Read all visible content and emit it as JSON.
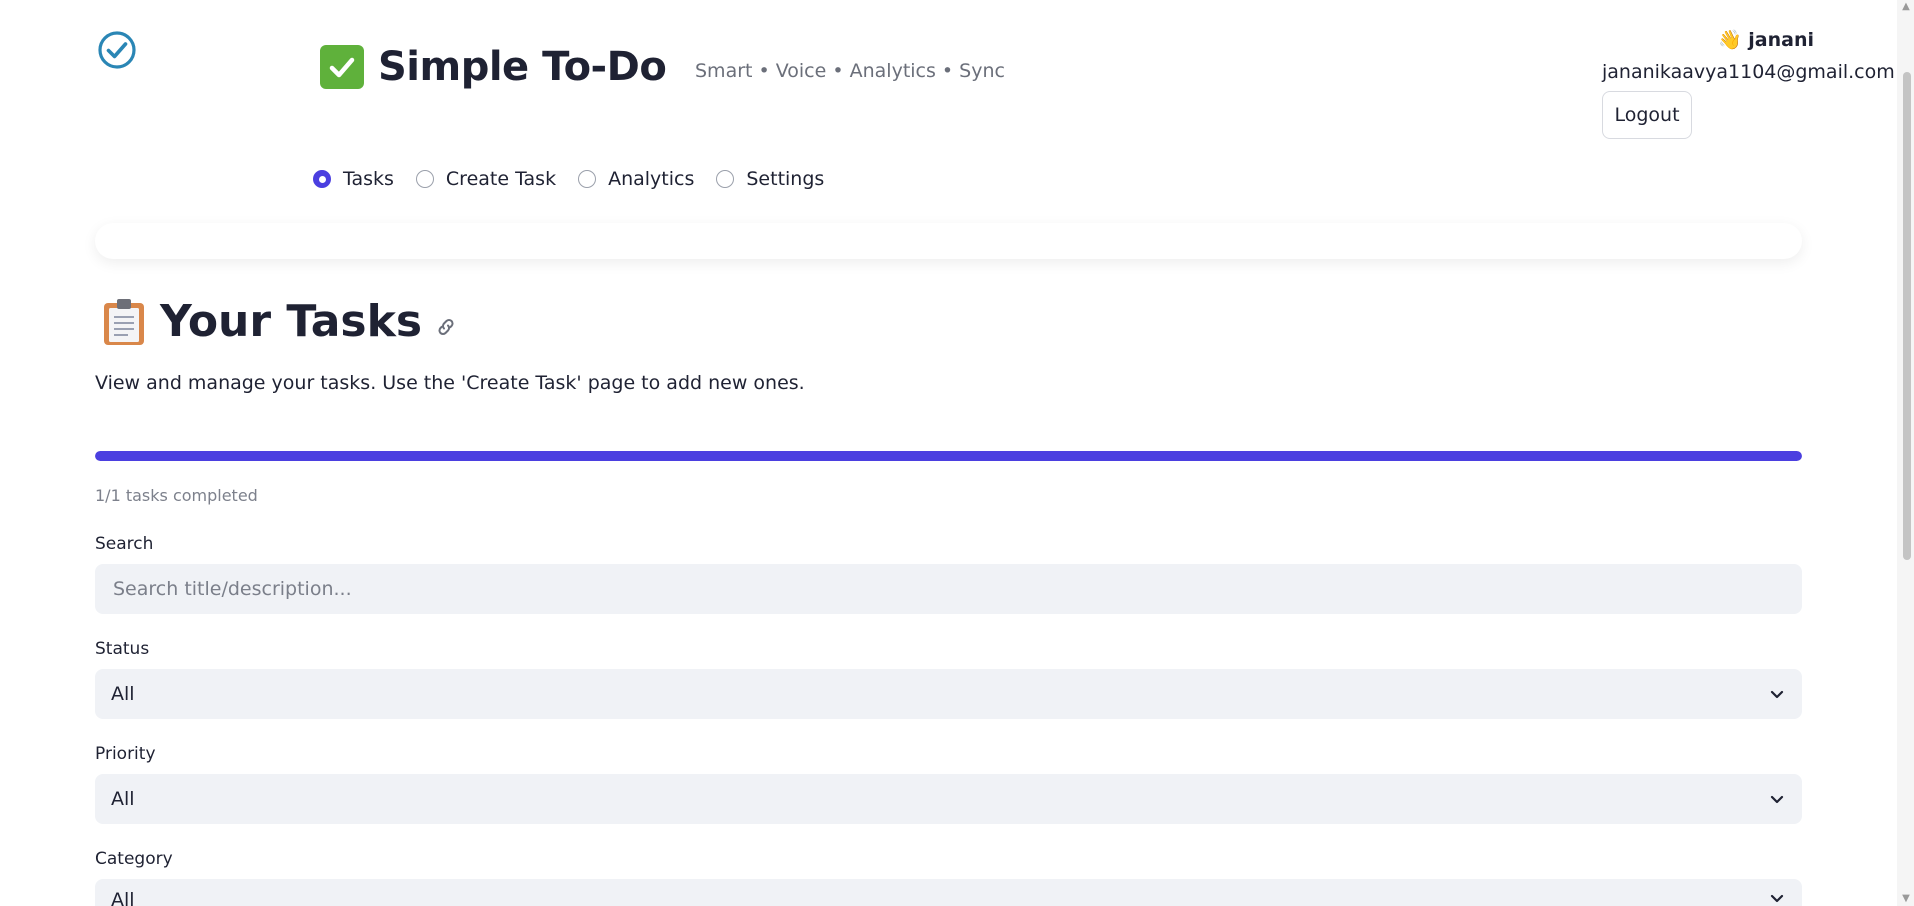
{
  "app": {
    "title": "Simple To-Do",
    "tagline": "Smart • Voice • Analytics • Sync"
  },
  "user": {
    "greeting": "👋 janani",
    "email": "jananikaavya1104@gmail.com",
    "logout_label": "Logout"
  },
  "nav": {
    "items": [
      {
        "label": "Tasks",
        "selected": true
      },
      {
        "label": "Create Task",
        "selected": false
      },
      {
        "label": "Analytics",
        "selected": false
      },
      {
        "label": "Settings",
        "selected": false
      }
    ]
  },
  "main": {
    "title": "Your Tasks",
    "description": "View and manage your tasks. Use the 'Create Task' page to add new ones.",
    "progress_fraction": 1.0,
    "progress_text": "1/1 tasks completed"
  },
  "filters": {
    "search": {
      "label": "Search",
      "placeholder": "Search title/description...",
      "value": ""
    },
    "status": {
      "label": "Status",
      "value": "All"
    },
    "priority": {
      "label": "Priority",
      "value": "All"
    },
    "category": {
      "label": "Category",
      "value": "All"
    }
  },
  "colors": {
    "accent": "#4b3fe0",
    "logo": "#2a86b5",
    "check_badge": "#5fb13b"
  },
  "icons": {
    "logo": "check-circle-icon",
    "title_badge": "check-mark-icon",
    "heading": "clipboard-icon",
    "anchor": "link-icon",
    "select": "chevron-down-icon"
  }
}
